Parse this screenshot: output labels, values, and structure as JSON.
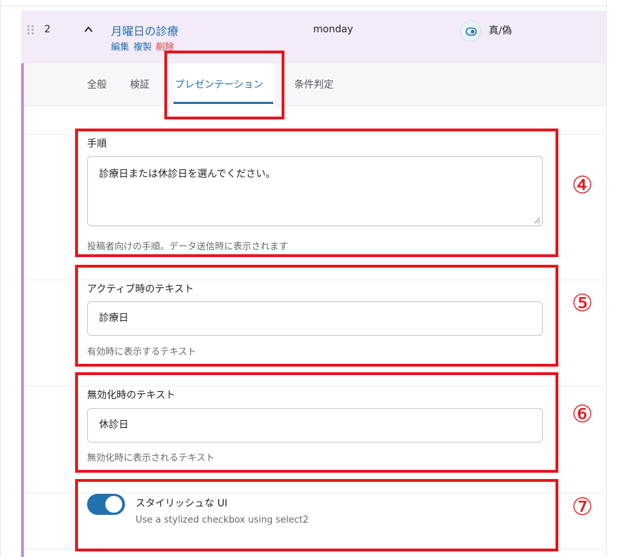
{
  "field_row": {
    "order": "2",
    "label": "月曜日の診療",
    "actions": {
      "edit": "編集",
      "duplicate": "複製",
      "delete": "削除"
    },
    "name": "monday",
    "type": "真/偽"
  },
  "tabs": [
    {
      "label": "全般"
    },
    {
      "label": "検証"
    },
    {
      "label": "プレゼンテーション"
    },
    {
      "label": "条件判定"
    }
  ],
  "instructions": {
    "label": "手順",
    "value": "診療日または休診日を選んでください。",
    "description": "投稿者向けの手順。データ送信時に表示されます"
  },
  "on_text": {
    "label": "アクティブ時のテキスト",
    "value": "診療日",
    "description": "有効時に表示するテキスト"
  },
  "off_text": {
    "label": "無効化時のテキスト",
    "value": "休診日",
    "description": "無効化時に表示されるテキスト"
  },
  "stylized_ui": {
    "title": "スタイリッシュな UI",
    "description": "Use a stylized checkbox using select2",
    "enabled": true
  },
  "annotations": [
    "④",
    "⑤",
    "⑥",
    "⑦"
  ],
  "colors": {
    "accent": "#2271b1",
    "row_bg": "#f3ebf7",
    "accent_bar": "#c48fd7",
    "annotation_red": "#e8141a",
    "delete_red": "#d63638"
  }
}
